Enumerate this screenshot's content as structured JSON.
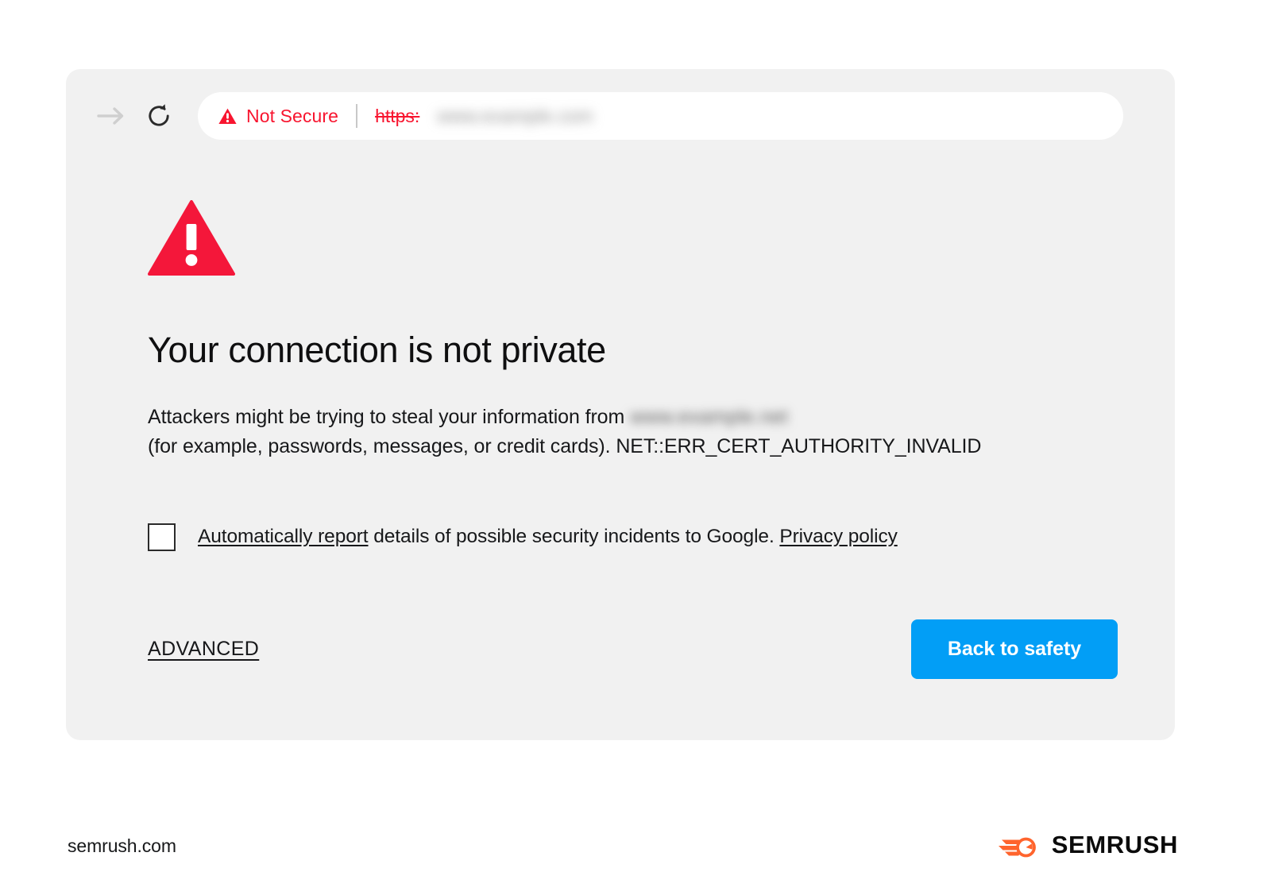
{
  "browser": {
    "toolbar": {
      "forward_icon": "arrow-right-icon",
      "reload_icon": "reload-icon",
      "omnibox": {
        "security_icon": "warning-triangle-icon",
        "security_label": "Not Secure",
        "url_scheme": "https:",
        "url_host": "www.example.com",
        "host_blurred": true
      }
    }
  },
  "interstitial": {
    "warning_icon": "warning-triangle-icon",
    "headline": "Your connection is not private",
    "body": {
      "lead": "Attackers might be trying to steal your information from",
      "host": "www.example.net",
      "tail": "(for example, passwords, messages, or credit cards). NET::ERR_CERT_AUTHORITY_INVALID",
      "error_code": "NET::ERR_CERT_AUTHORITY_INVALID"
    },
    "report": {
      "checked": false,
      "link_text": "Automatically report",
      "middle_text": " details of possible security incidents to Google. ",
      "policy_link": "Privacy policy"
    },
    "actions": {
      "advanced_label": "ADVANCED",
      "back_to_safety_label": "Back to safety"
    }
  },
  "footer": {
    "domain": "semrush.com",
    "logo_icon": "semrush-comet-icon",
    "logo_word": "SEMRUSH"
  },
  "colors": {
    "alert_red": "#f8152f",
    "button_blue": "#029ef6",
    "card_gray": "#f1f1f1",
    "brand_orange": "#ff642d",
    "text_dark": "#17181a"
  }
}
